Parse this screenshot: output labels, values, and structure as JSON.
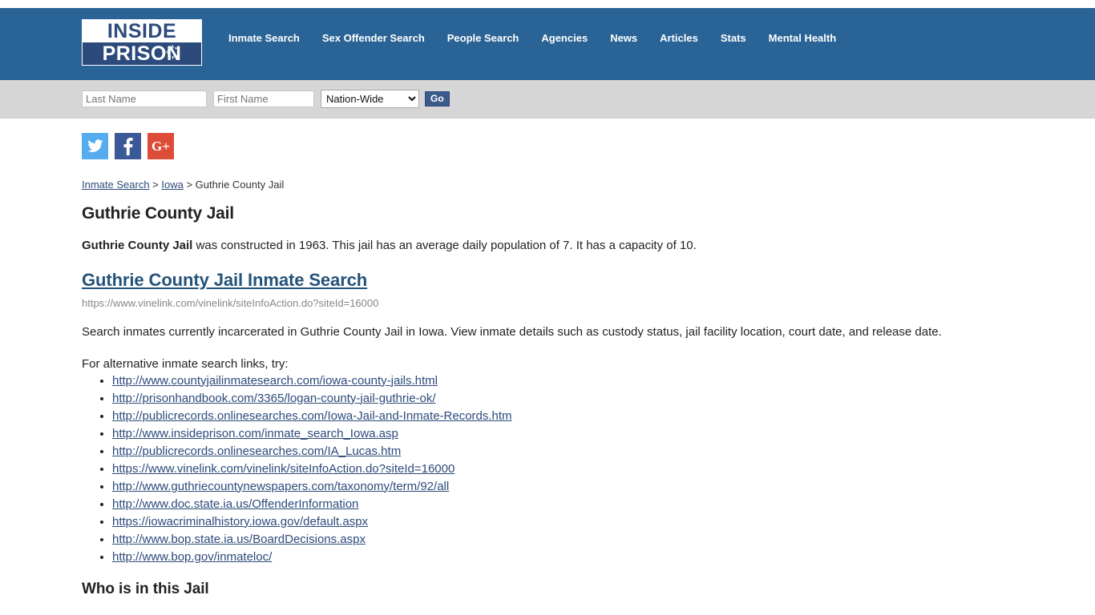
{
  "header": {
    "logo": {
      "line1": "INSIDE",
      "line2": "PRISON",
      "wire_icon": "barbed-wire-circle-icon"
    },
    "nav": [
      {
        "label": "Inmate Search"
      },
      {
        "label": "Sex Offender Search"
      },
      {
        "label": "People Search"
      },
      {
        "label": "Agencies"
      },
      {
        "label": "News"
      },
      {
        "label": "Articles"
      },
      {
        "label": "Stats"
      },
      {
        "label": "Mental Health"
      }
    ],
    "band_color": "#2a6496"
  },
  "search_bar": {
    "last_name_placeholder": "Last Name",
    "last_name_value": "",
    "first_name_placeholder": "First Name",
    "first_name_value": "",
    "region_selected": "Nation-Wide",
    "region_options": [
      "Nation-Wide"
    ],
    "go_label": "Go",
    "go_color": "#3b5a8c",
    "background": "#d6d6d6"
  },
  "social": [
    {
      "name": "twitter-icon",
      "label": "Twitter",
      "color": "#55acee"
    },
    {
      "name": "facebook-icon",
      "label": "Facebook",
      "color": "#3b5998"
    },
    {
      "name": "googleplus-icon",
      "label": "G+",
      "glyph": "G+",
      "color": "#dd4b39"
    }
  ],
  "breadcrumb": {
    "items": [
      {
        "label": "Inmate Search",
        "link": true
      },
      {
        "label": "Iowa",
        "link": true
      },
      {
        "label": "Guthrie County Jail",
        "link": false
      }
    ],
    "separator": " > "
  },
  "main": {
    "page_title": "Guthrie County Jail",
    "intro_bold": "Guthrie County Jail",
    "intro_rest": " was constructed in 1963. This jail has an average daily population of 7. It has a capacity of 10.",
    "search_heading": "Guthrie County Jail Inmate Search",
    "search_url": "https://www.vinelink.com/vinelink/siteInfoAction.do?siteId=16000",
    "search_description": "Search inmates currently incarcerated in Guthrie County Jail in Iowa. View inmate details such as custody status, jail facility location, court date, and release date.",
    "alt_links_intro": "For alternative inmate search links, try:",
    "alt_links": [
      "http://www.countyjailinmatesearch.com/iowa-county-jails.html",
      "http://prisonhandbook.com/3365/logan-county-jail-guthrie-ok/",
      "http://publicrecords.onlinesearches.com/Iowa-Jail-and-Inmate-Records.htm",
      "http://www.insideprison.com/inmate_search_Iowa.asp",
      "http://publicrecords.onlinesearches.com/IA_Lucas.htm",
      "https://www.vinelink.com/vinelink/siteInfoAction.do?siteId=16000",
      "http://www.guthriecountynewspapers.com/taxonomy/term/92/all",
      "http://www.doc.state.ia.us/OffenderInformation",
      "https://iowacriminalhistory.iowa.gov/default.aspx",
      "http://www.bop.state.ia.us/BoardDecisions.aspx",
      "http://www.bop.gov/inmateloc/"
    ],
    "who_heading": "Who is in this Jail",
    "link_color": "#2c4a7c",
    "heading_link_color": "#24527a"
  }
}
